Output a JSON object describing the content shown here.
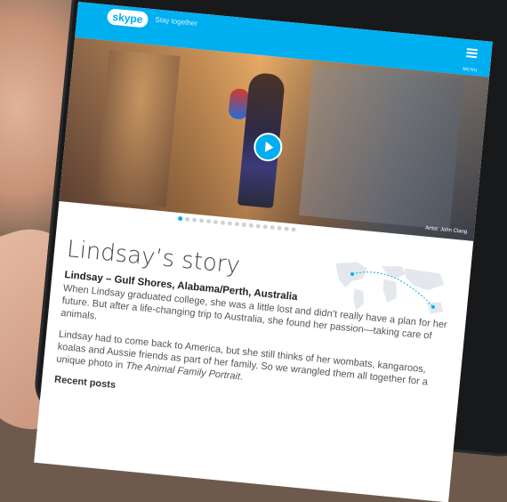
{
  "header": {
    "logo_text": "skype",
    "tagline": "Stay together",
    "menu_label": "MENU",
    "brand_color": "#00aff0"
  },
  "hero": {
    "credit": "Artist: John Clang",
    "play_icon": "play-icon",
    "slide_count": 17,
    "active_slide": 1
  },
  "article": {
    "title": "Lindsay’s story",
    "location": "Lindsay – Gulf Shores, Alabama/Perth, Australia",
    "para1": "When Lindsay graduated college, she was a little lost and didn’t really have a plan for her future. But after a life-changing trip to Australia, she found her passion—taking care of animals.",
    "para2_a": "Lindsay had to come back to America, but she still thinks of her wombats, kangaroos, koalas and Aussie friends as part of her family. So we wrangled them all together for a unique photo in ",
    "para2_em": "The Animal Family Portrait",
    "para2_b": ".",
    "recent_posts": "Recent posts"
  }
}
